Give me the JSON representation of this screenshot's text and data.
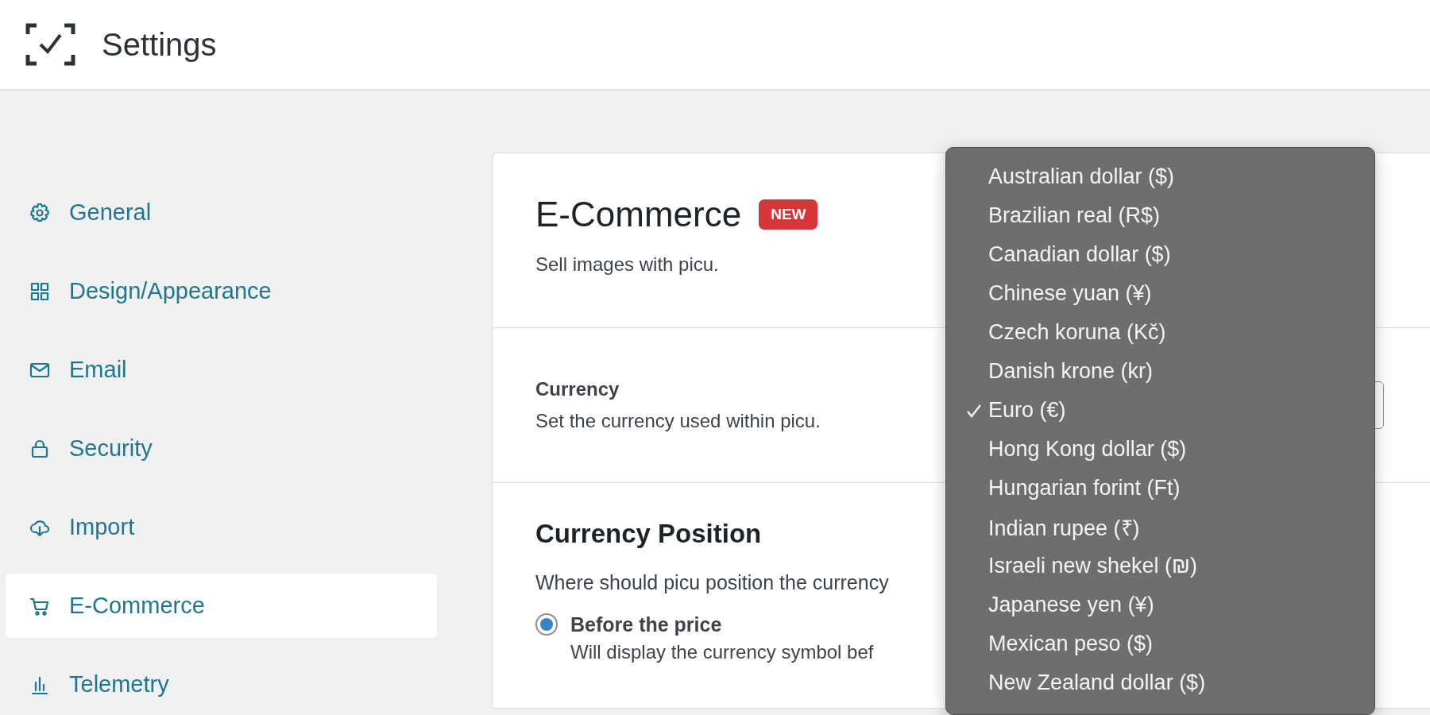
{
  "header": {
    "title": "Settings"
  },
  "sidebar": {
    "items": [
      {
        "label": "General",
        "selected": false
      },
      {
        "label": "Design/Appearance",
        "selected": false
      },
      {
        "label": "Email",
        "selected": false
      },
      {
        "label": "Security",
        "selected": false
      },
      {
        "label": "Import",
        "selected": false
      },
      {
        "label": "E-Commerce",
        "selected": true
      },
      {
        "label": "Telemetry",
        "selected": false
      }
    ]
  },
  "card": {
    "title": "E-Commerce",
    "badge": "NEW",
    "subtitle": "Sell images with picu.",
    "currency": {
      "label": "Currency",
      "description": "Set the currency used within picu."
    },
    "position": {
      "heading": "Currency Position",
      "prompt": "Where should picu position the currency",
      "options": [
        {
          "label": "Before the price",
          "description": "Will display the currency symbol bef",
          "selected": true
        }
      ]
    }
  },
  "menu": {
    "items": [
      {
        "label": "Australian dollar ($)",
        "checked": false
      },
      {
        "label": "Brazilian real (R$)",
        "checked": false
      },
      {
        "label": "Canadian dollar ($)",
        "checked": false
      },
      {
        "label": "Chinese yuan (¥)",
        "checked": false
      },
      {
        "label": "Czech koruna (Kč)",
        "checked": false
      },
      {
        "label": "Danish krone (kr)",
        "checked": false
      },
      {
        "label": "Euro (€)",
        "checked": true
      },
      {
        "label": "Hong Kong dollar ($)",
        "checked": false
      },
      {
        "label": "Hungarian forint (Ft)",
        "checked": false
      },
      {
        "label": "Indian rupee (₹)",
        "checked": false
      },
      {
        "label": "Israeli new shekel (₪)",
        "checked": false
      },
      {
        "label": "Japanese yen (¥)",
        "checked": false
      },
      {
        "label": "Mexican peso ($)",
        "checked": false
      },
      {
        "label": "New Zealand dollar ($)",
        "checked": false
      }
    ]
  }
}
